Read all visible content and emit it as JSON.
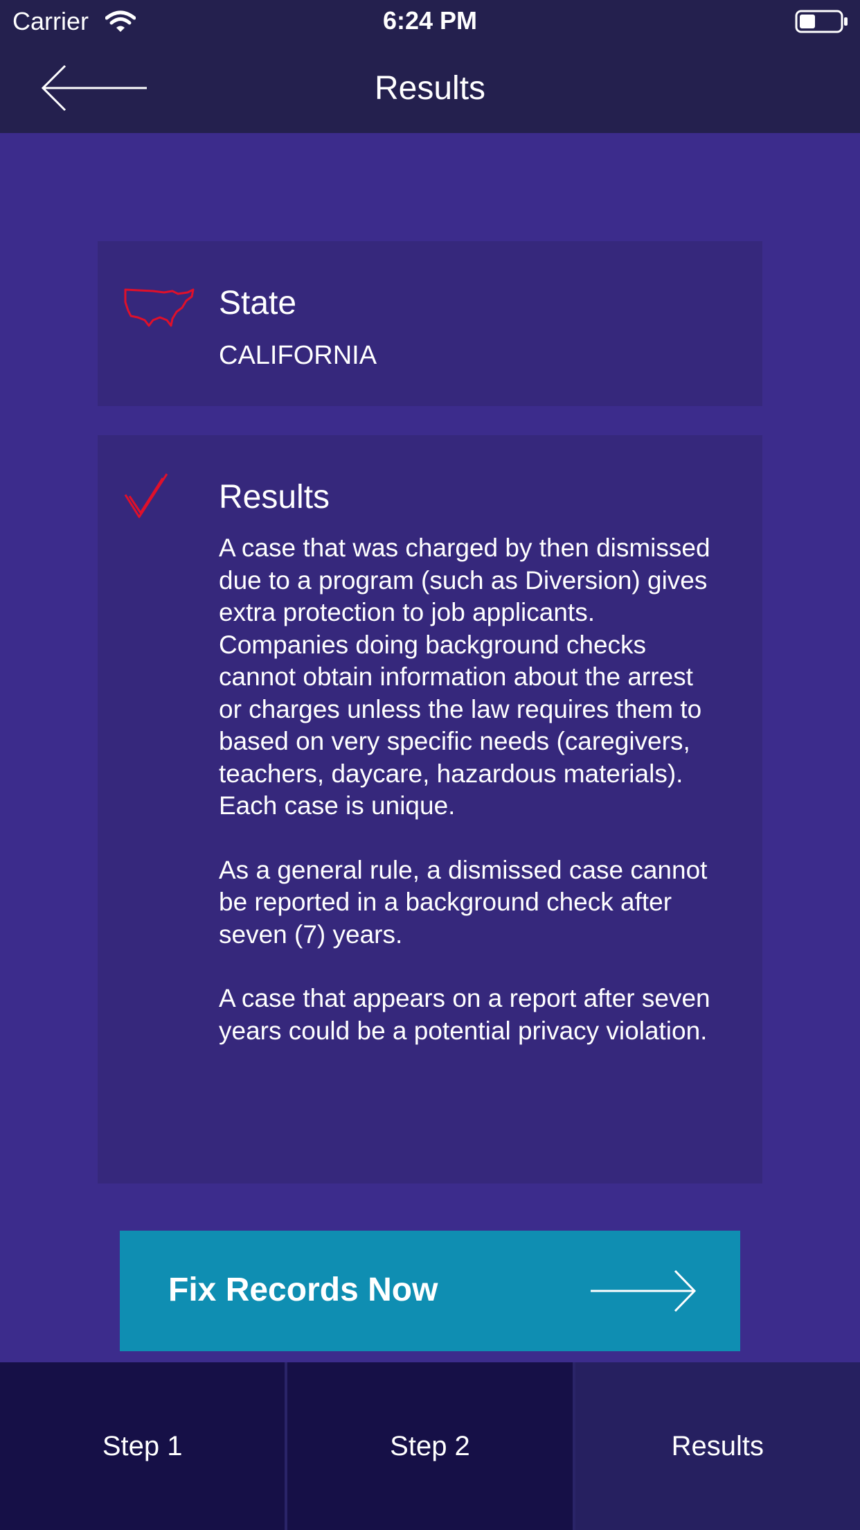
{
  "status_bar": {
    "carrier": "Carrier",
    "time": "6:24 PM",
    "icons": [
      "wifi-icon",
      "battery-icon"
    ]
  },
  "nav": {
    "title": "Results",
    "back_icon": "arrow-left-icon"
  },
  "state_card": {
    "icon": "usa-map-icon",
    "heading": "State",
    "value": "CALIFORNIA"
  },
  "results_card": {
    "icon": "checkmark-icon",
    "heading": "Results",
    "paragraphs": [
      "A case that was charged by then dismissed due to a program (such as Diversion) gives extra protection to job applicants.  Companies doing background checks cannot obtain information about the arrest or charges unless the law requires them to based on very specific needs (caregivers, teachers, daycare, hazardous materials).  Each case is unique.",
      "As a general rule, a dismissed case cannot be reported in a background check after seven (7) years.",
      "A case that appears on a report after seven years could be a potential privacy violation."
    ]
  },
  "cta": {
    "label": "Fix Records Now",
    "icon": "arrow-right-icon"
  },
  "tabs": [
    {
      "label": "Step 1"
    },
    {
      "label": "Step 2"
    },
    {
      "label": "Results"
    }
  ],
  "colors": {
    "background": "#3c2c8c",
    "bars": "#24204e",
    "card": "#36287c",
    "accent_icon": "#e0102a",
    "cta": "#0f8eb2",
    "tab": "#161047",
    "tab_active": "#262060"
  }
}
